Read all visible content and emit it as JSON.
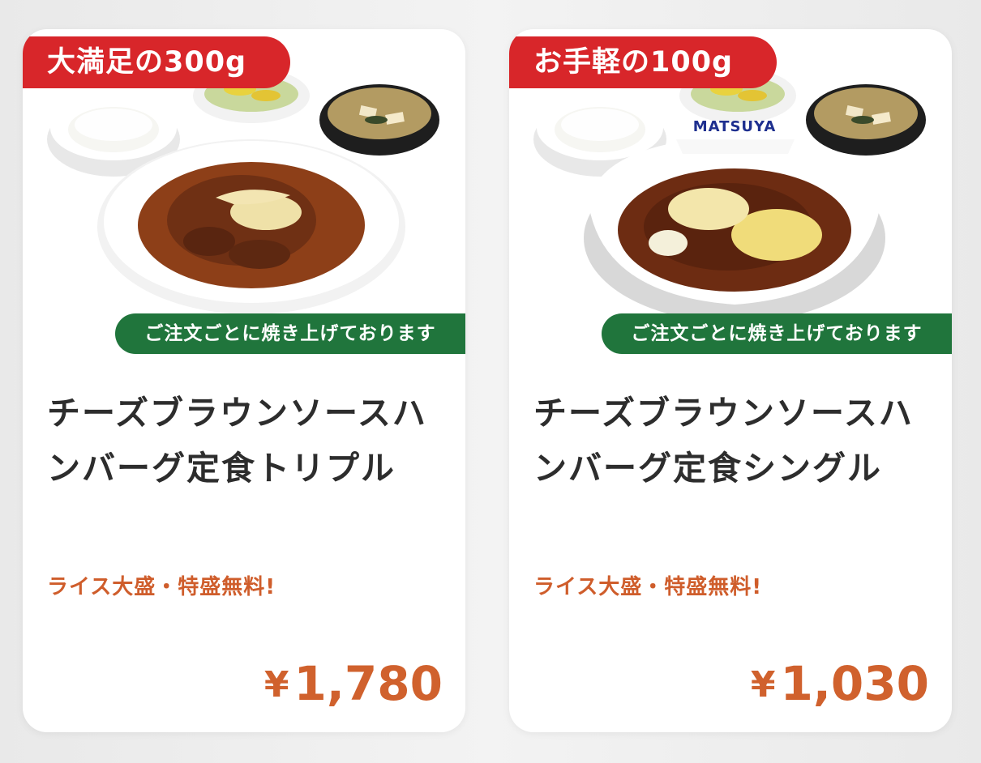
{
  "products": [
    {
      "weight_badge": "大満足の300g",
      "cook_badge": "ご注文ごとに焼き上げております",
      "title": "チーズブラウンソースハンバーグ定食トリプル",
      "note": "ライス大盛・特盛無料!",
      "currency": "¥",
      "price": "1,780"
    },
    {
      "weight_badge": "お手軽の100g",
      "cook_badge": "ご注文ごとに焼き上げております",
      "title": "チーズブラウンソースハンバーグ定食シングル",
      "note": "ライス大盛・特盛無料!",
      "currency": "¥",
      "price": "1,030",
      "brand_logo": "MATSUYA"
    }
  ],
  "colors": {
    "badge_red": "#d8262a",
    "badge_green": "#20753c",
    "price_orange": "#d0612d",
    "title_dark": "#2d2d2d"
  }
}
